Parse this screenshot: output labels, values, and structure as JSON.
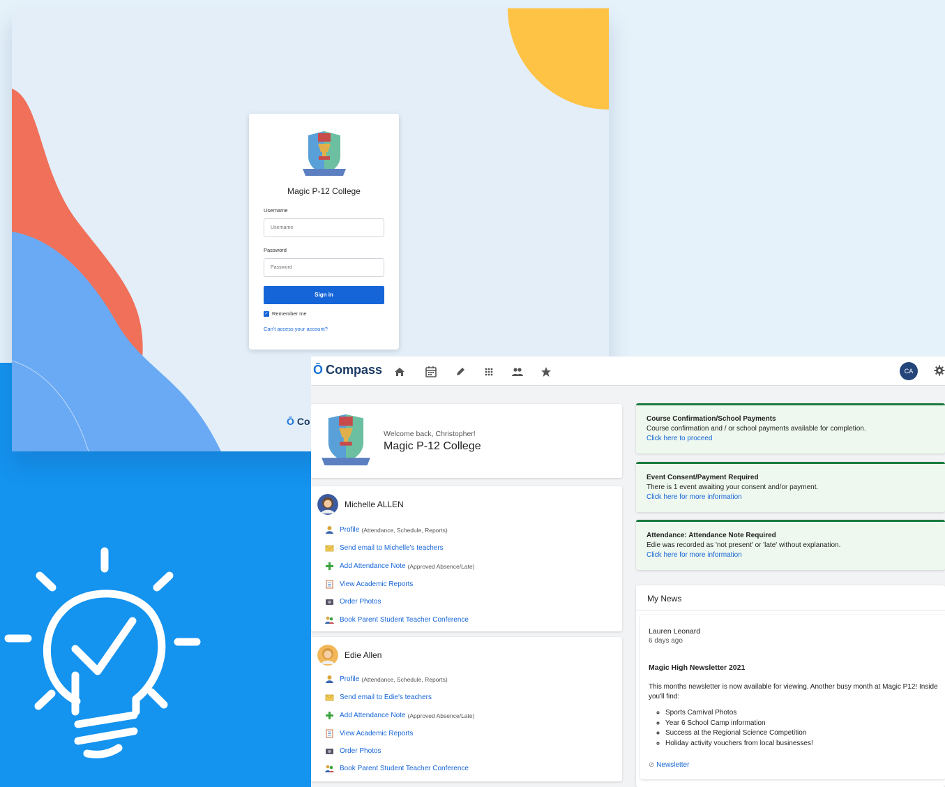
{
  "login": {
    "school_name": "Magic P-12 College",
    "crest_caption": "Magic P-12 College",
    "username_label": "Username",
    "username_placeholder": "Username",
    "password_label": "Password",
    "password_placeholder": "Password",
    "signin_label": "Sign in",
    "remember_label": "Remember me",
    "remember_checked": true,
    "cant_access_label": "Can't access your account?",
    "footer_brand": "Co"
  },
  "dashboard": {
    "brand": "Compass",
    "nav_icons": [
      "home-icon",
      "calendar-icon",
      "pencil-icon",
      "apps-grid-icon",
      "people-icon",
      "star-icon"
    ],
    "user_initials": "CA",
    "welcome": {
      "greeting": "Welcome back, Christopher!",
      "school_name": "Magic P-12 College",
      "crest_caption": "Magic P-12 College"
    },
    "students": [
      {
        "name": "Michelle ALLEN",
        "links": [
          {
            "label": "Profile",
            "note": "(Attendance, Schedule, Reports)",
            "icon": "profile-icon"
          },
          {
            "label": "Send email to Michelle's teachers",
            "note": "",
            "icon": "email-icon"
          },
          {
            "label": "Add Attendance Note",
            "note": "(Approved Absence/Late)",
            "icon": "plus-icon"
          },
          {
            "label": "View Academic Reports",
            "note": "",
            "icon": "report-icon"
          },
          {
            "label": "Order Photos",
            "note": "",
            "icon": "camera-icon"
          },
          {
            "label": "Book Parent Student Teacher Conference",
            "note": "",
            "icon": "conference-icon"
          }
        ]
      },
      {
        "name": "Edie Allen",
        "links": [
          {
            "label": "Profile",
            "note": "(Attendance, Schedule, Reports)",
            "icon": "profile-icon"
          },
          {
            "label": "Send email to Edie's teachers",
            "note": "",
            "icon": "email-icon"
          },
          {
            "label": "Add Attendance Note",
            "note": "(Approved Absence/Late)",
            "icon": "plus-icon"
          },
          {
            "label": "View Academic Reports",
            "note": "",
            "icon": "report-icon"
          },
          {
            "label": "Order Photos",
            "note": "",
            "icon": "camera-icon"
          },
          {
            "label": "Book Parent Student Teacher Conference",
            "note": "",
            "icon": "conference-icon"
          }
        ]
      }
    ],
    "alerts": [
      {
        "title": "Course Confirmation/School Payments",
        "desc": "Course confirmation and / or school payments available for completion.",
        "link": "Click here to proceed"
      },
      {
        "title": "Event Consent/Payment Required",
        "desc": "There is 1 event awaiting your consent and/or payment.",
        "link": "Click here for more information"
      },
      {
        "title": "Attendance: Attendance Note Required",
        "desc": "Edie was recorded as 'not present' or 'late' without explanation.",
        "link": "Click here for more information"
      }
    ],
    "news": {
      "heading": "My News",
      "post": {
        "author": "Lauren Leonard",
        "ago": "6 days ago",
        "title": "Magic High Newsletter 2021",
        "body": "This months newsletter is now available for viewing. Another busy month at Magic P12! Inside you'll find:",
        "items": [
          "Sports Carnival Photos",
          "Year 6 School Camp information",
          "Success at the Regional Science Competition",
          "Holiday activity vouchers from local businesses!"
        ],
        "attachment": "Newsletter"
      }
    }
  },
  "colors": {
    "accent_blue": "#1565d8",
    "brand_navy": "#1a3a63",
    "alert_green": "#1b7a3f",
    "panel_blue": "#1493ef"
  }
}
